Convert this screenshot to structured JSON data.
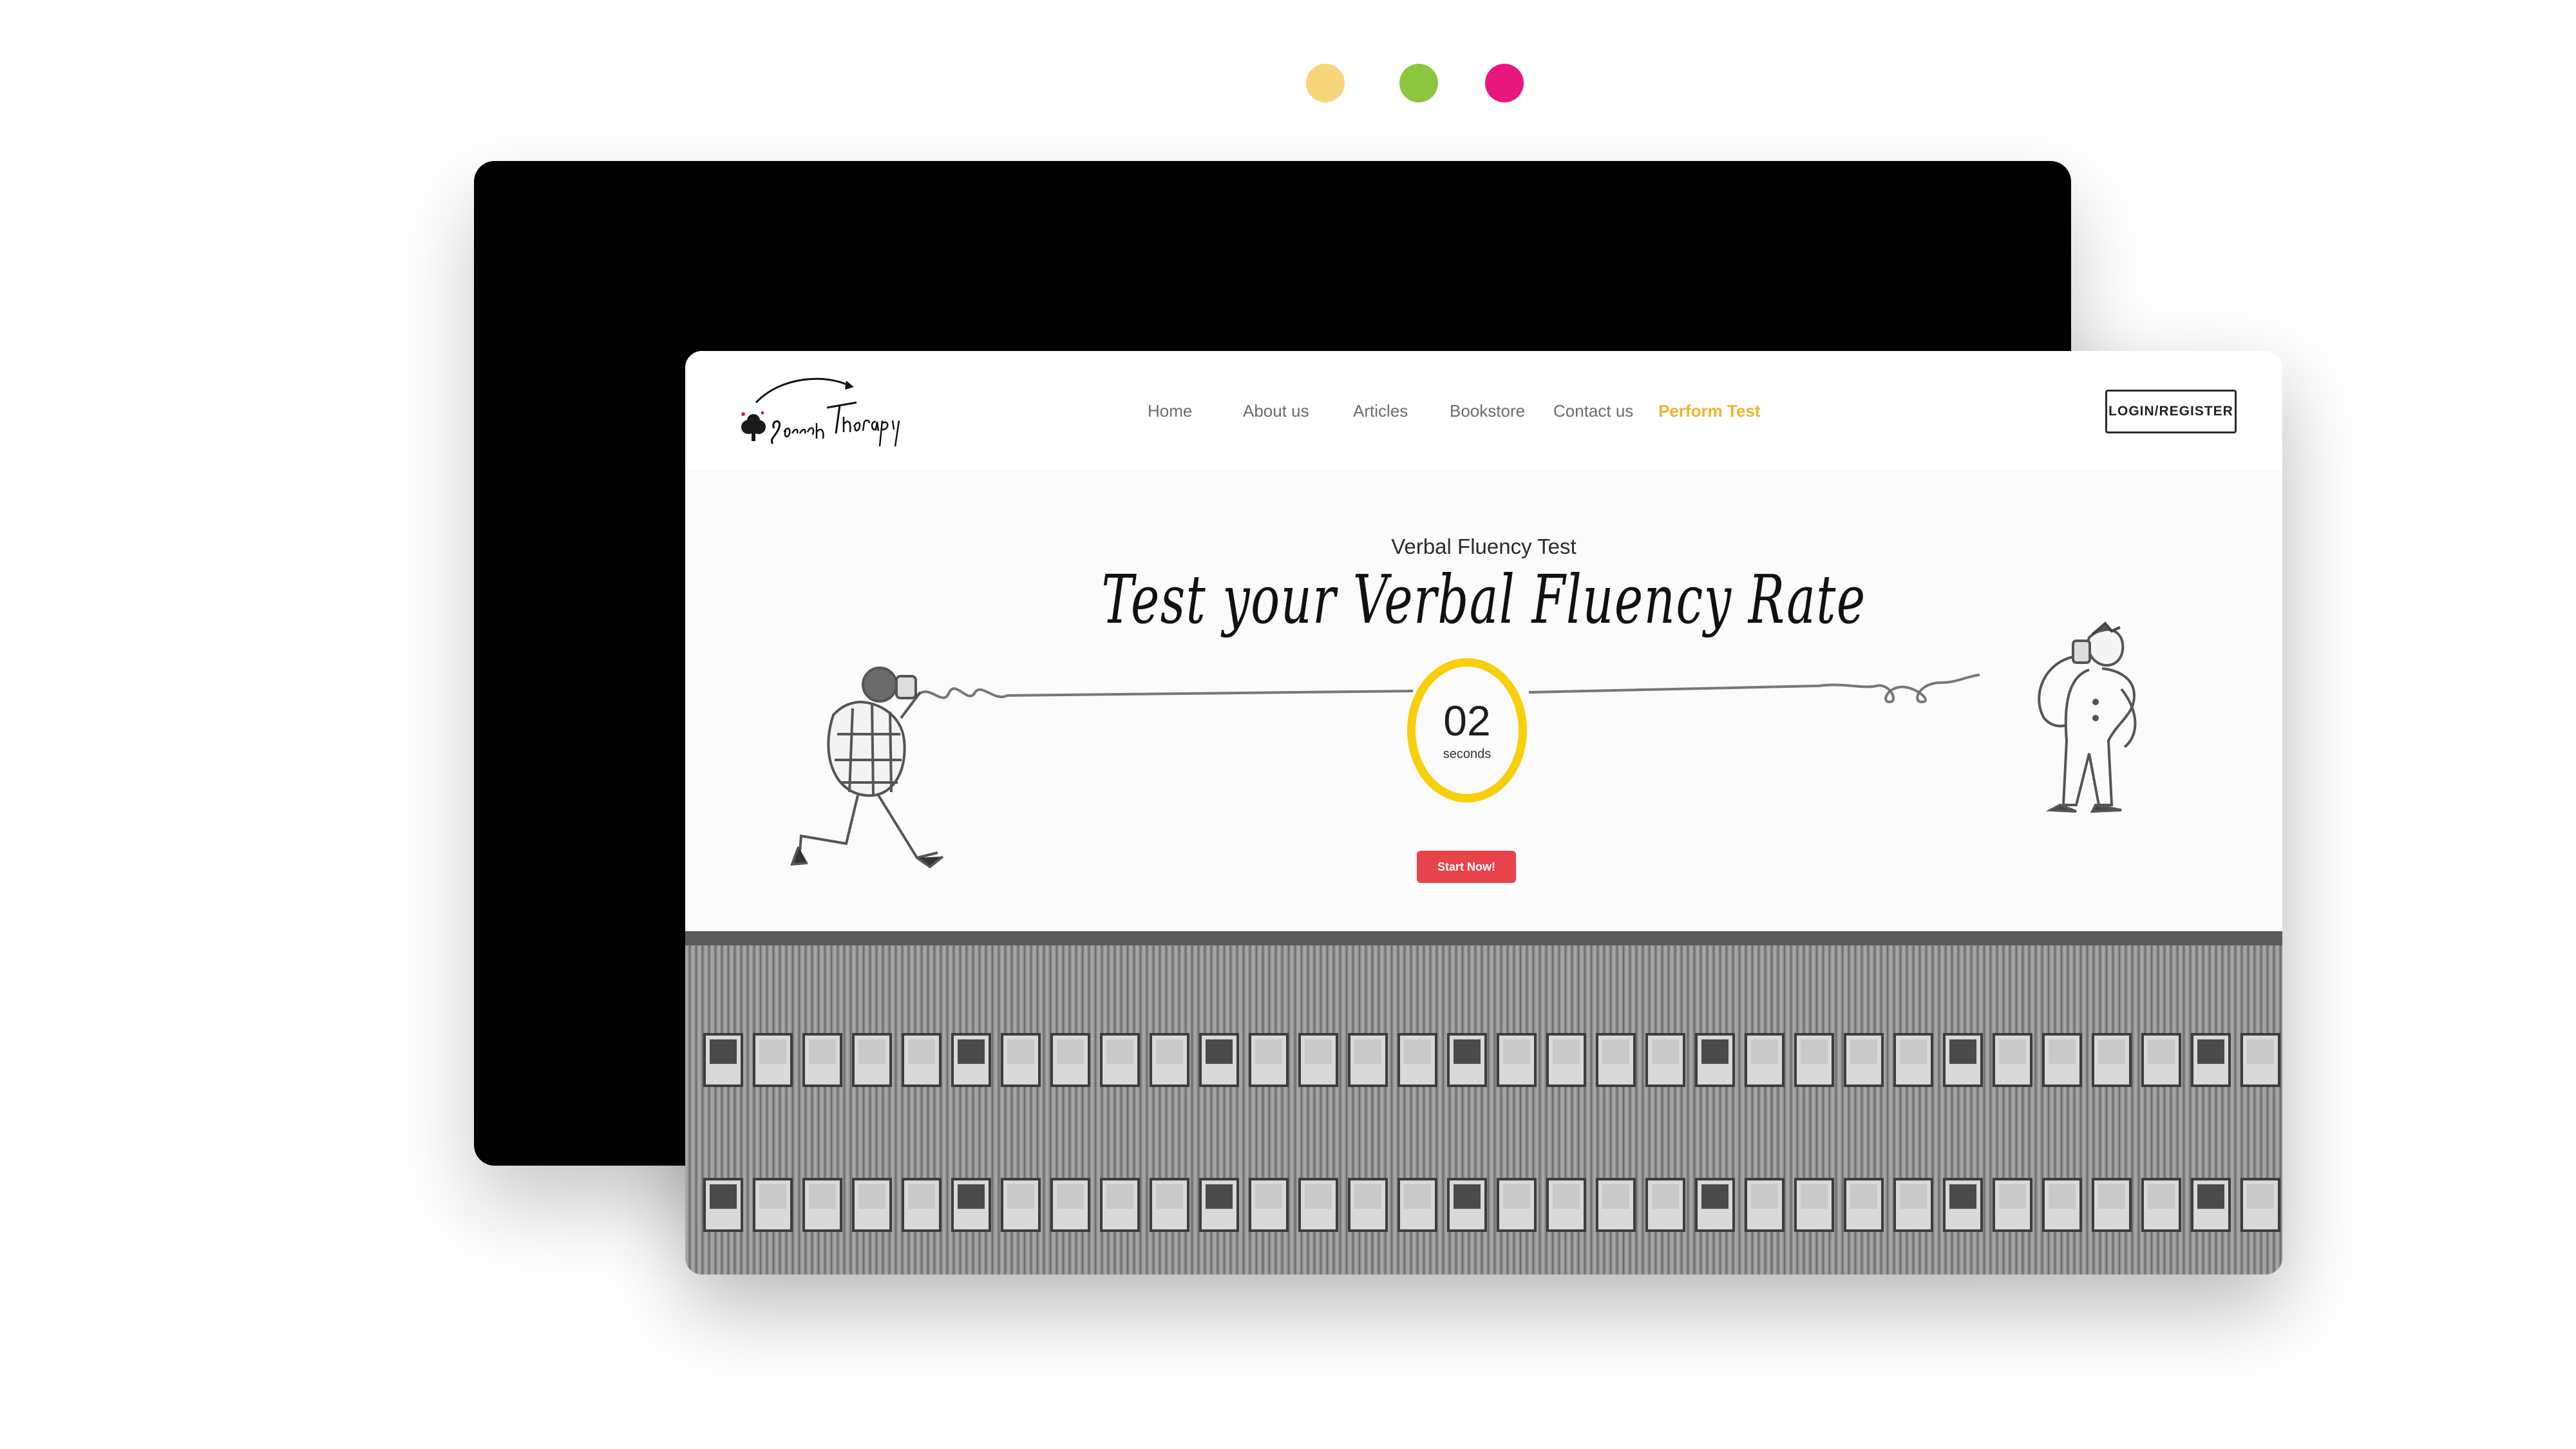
{
  "window_controls": {
    "colors": [
      "#f7d57a",
      "#8cc63f",
      "#e8177d"
    ],
    "icons": [
      "window-dot-yellow",
      "window-dot-green",
      "window-dot-pink"
    ]
  },
  "brand": {
    "logo_text": "Speech Therapy"
  },
  "nav": {
    "items": [
      {
        "label": "Home"
      },
      {
        "label": "About us"
      },
      {
        "label": "Articles"
      },
      {
        "label": "Bookstore"
      },
      {
        "label": "Contact us"
      },
      {
        "label": "Perform Test",
        "active": true
      }
    ],
    "active_color": "#f2b22c",
    "login_label": "LOGIN/REGISTER"
  },
  "hero": {
    "subtitle": "Verbal Fluency Test",
    "title": "Test your Verbal Fluency Rate",
    "timer": {
      "value": "02",
      "unit": "seconds",
      "ring_color": "#f7cf0a"
    },
    "start_label": "Start Now!",
    "start_color": "#e8434b"
  }
}
